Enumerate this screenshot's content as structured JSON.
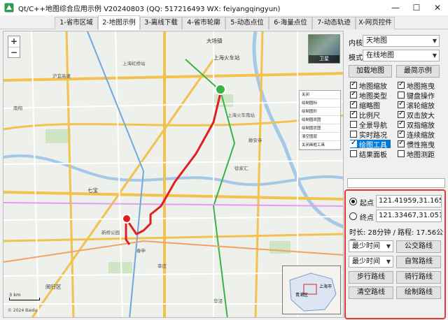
{
  "window": {
    "title": "Qt/C++地图综合应用示例 V20240803 (QQ: 517216493 WX: feiyangqingyun)",
    "minimize": "—",
    "maximize": "☐",
    "close": "✕"
  },
  "tabs": [
    "1-省市区域",
    "2-地图示例",
    "3-离线下载",
    "4-省市轮廓",
    "5-动态点位",
    "6-海量点位",
    "7-动态轨迹",
    "X-网页控件"
  ],
  "active_tab": 1,
  "map": {
    "zoom_in": "+",
    "zoom_out": "−",
    "satellite_label": "卫星",
    "draw_tools": [
      "关闭",
      "绘制圆标",
      "绘制圆形",
      "绘制圆状图",
      "绘制圆状图",
      "清空图层",
      "关闭画框工具"
    ],
    "labels": [
      {
        "text": "大场镇",
        "big": true
      },
      {
        "text": "沪宜高速",
        "big": false
      },
      {
        "text": "上海虹桥站",
        "big": false
      },
      {
        "text": "上海火车南站",
        "big": false
      },
      {
        "text": "上海火车站",
        "big": true
      },
      {
        "text": "静安寺",
        "big": false
      },
      {
        "text": "南翔",
        "big": false
      },
      {
        "text": "七宝",
        "big": true
      },
      {
        "text": "春申",
        "big": false
      },
      {
        "text": "新桥公园",
        "big": false
      },
      {
        "text": "莘庄",
        "big": false
      },
      {
        "text": "闵行区",
        "big": true
      },
      {
        "text": "徐家汇",
        "big": false
      },
      {
        "text": "华泾",
        "big": false
      }
    ],
    "scale_text": "3 km",
    "copyright": "© 2024 Baidu",
    "overview_labels": [
      "青浦区",
      "上海市"
    ]
  },
  "panel": {
    "kernel_label": "内核",
    "kernel_value": "天地图",
    "mode_label": "模式",
    "mode_value": "在线地图",
    "load_map_button": "加载地图",
    "simple_demo_button": "最简示例",
    "checkboxes": [
      {
        "label": "地图缩放",
        "checked": true,
        "highlight": false
      },
      {
        "label": "地图类型",
        "checked": true,
        "highlight": false
      },
      {
        "label": "缩略图",
        "checked": true,
        "highlight": false
      },
      {
        "label": "比例尺",
        "checked": true,
        "highlight": false
      },
      {
        "label": "全景导航",
        "checked": false,
        "highlight": false
      },
      {
        "label": "实时路况",
        "checked": false,
        "highlight": false
      },
      {
        "label": "绘图工具",
        "checked": true,
        "highlight": true
      },
      {
        "label": "结果面板",
        "checked": false,
        "highlight": false
      },
      {
        "label": "地图拖曳",
        "checked": true,
        "highlight": false
      },
      {
        "label": "键盘操作",
        "checked": false,
        "highlight": false
      },
      {
        "label": "滚轮缩放",
        "checked": true,
        "highlight": false
      },
      {
        "label": "双击放大",
        "checked": true,
        "highlight": false
      },
      {
        "label": "双指缩放",
        "checked": true,
        "highlight": false
      },
      {
        "label": "连续缩放",
        "checked": true,
        "highlight": false
      },
      {
        "label": "惯性拖曳",
        "checked": true,
        "highlight": false
      },
      {
        "label": "地图测距",
        "checked": false,
        "highlight": false
      }
    ]
  },
  "route": {
    "start_label": "起点",
    "start_value": "121.41959,31.16523",
    "end_label": "终点",
    "end_value": "121.33467,31.05128",
    "summary": "时长: 28分钟 / 路程: 17.56公里",
    "policy1": "最少时间",
    "bus_button": "公交路线",
    "policy2": "最少时间",
    "drive_button": "自驾路线",
    "walk_button": "步行路线",
    "ride_button": "骑行路线",
    "clear_button": "清空路线",
    "draw_button": "绘制路线"
  },
  "colors": {
    "route": "#e02020",
    "metro_green": "#3cb14a",
    "highway": "#f2c14e",
    "water": "#a5c8e6",
    "accent": "#0078d7",
    "route_box": "#e53935"
  }
}
